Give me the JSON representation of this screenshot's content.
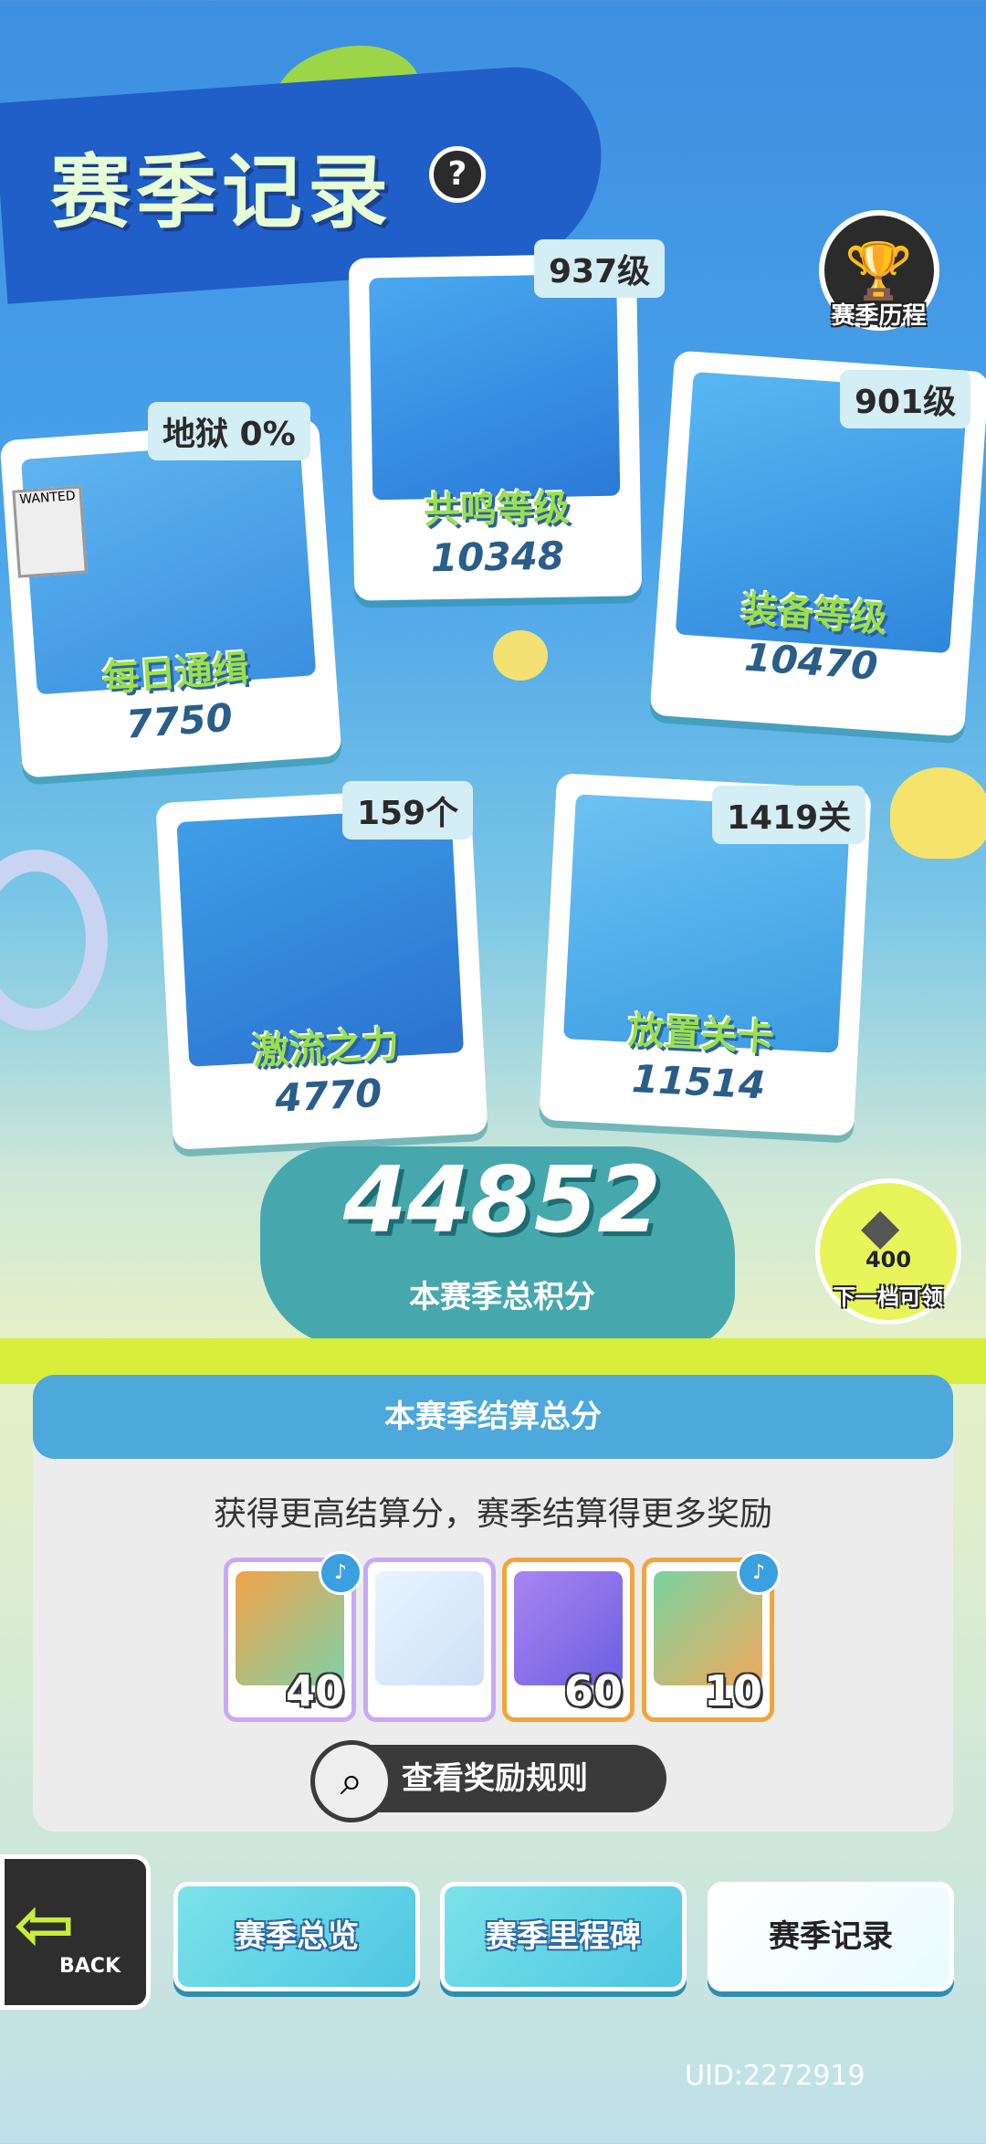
{
  "header": {
    "title": "赛季记录",
    "help_icon": "?",
    "journey_label": "赛季历程"
  },
  "cards": {
    "daily": {
      "name": "每日通缉",
      "value": "7750",
      "tag": "地狱 0%",
      "wanted_label": "WANTED"
    },
    "resonance": {
      "name": "共鸣等级",
      "value": "10348",
      "tag": "937级"
    },
    "equipment": {
      "name": "装备等级",
      "value": "10470",
      "tag": "901级"
    },
    "surge": {
      "name": "激流之力",
      "value": "4770",
      "tag": "159个"
    },
    "idle": {
      "name": "放置关卡",
      "value": "11514",
      "tag": "1419关"
    }
  },
  "score": {
    "total": "44852",
    "label": "本赛季总积分"
  },
  "next_reward": {
    "amount": "400",
    "label": "下一档可领"
  },
  "settlement": {
    "title": "本赛季结算总分",
    "subtitle": "获得更高结算分，赛季结算得更多奖励",
    "rewards": [
      {
        "count": "40",
        "mark": "♪"
      },
      {
        "count": "",
        "mark": ""
      },
      {
        "count": "60",
        "mark": ""
      },
      {
        "count": "10",
        "mark": "♪"
      }
    ],
    "rules_label": "查看奖励规则"
  },
  "nav": {
    "back_label": "BACK",
    "tabs": [
      "赛季总览",
      "赛季里程碑",
      "赛季记录"
    ]
  },
  "uid": "UID:2272919",
  "colors": {
    "accent": "#4da8dc",
    "lime": "#d7ee3a",
    "orange_frame": "#f2a53c"
  }
}
